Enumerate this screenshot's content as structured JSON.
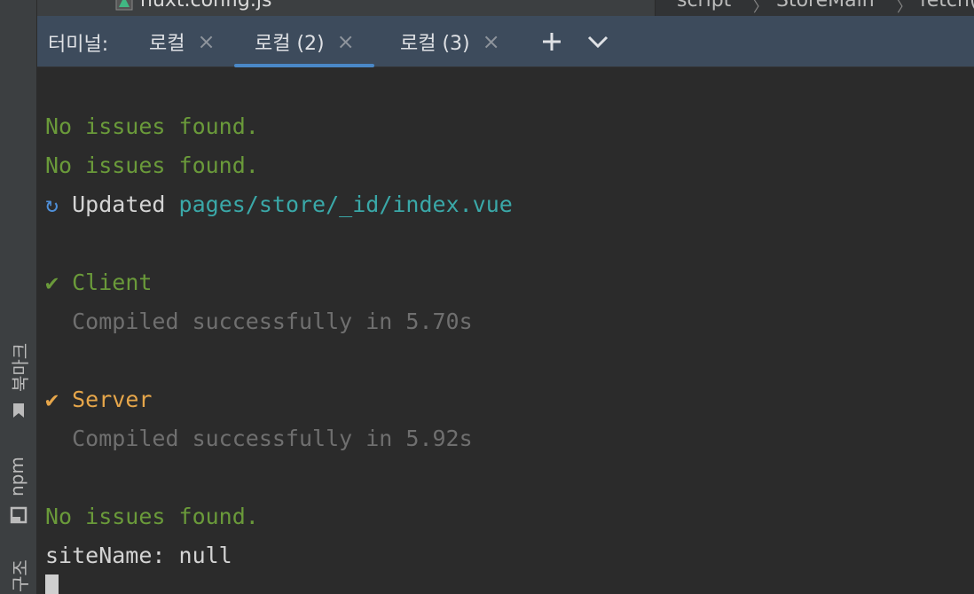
{
  "top_strip": {
    "file_name": "nuxt.config.js",
    "breadcrumb": [
      "script",
      "StoreMain",
      "fetch()"
    ]
  },
  "terminal": {
    "title": "터미널:",
    "tabs": [
      {
        "label": "로컬",
        "active": false
      },
      {
        "label": "로컬 (2)",
        "active": true
      },
      {
        "label": "로컬 (3)",
        "active": false
      }
    ],
    "add_icon": "plus-icon",
    "menu_icon": "chevron-down-icon",
    "lines": [
      {
        "text": "No issues found."
      },
      {
        "text": "No issues found."
      },
      {
        "symbol": "↻",
        "text": "Updated",
        "path": "pages/store/_id/index.vue"
      },
      {
        "symbol": "✔",
        "text": "Client"
      },
      {
        "text": "Compiled successfully in 5.70s"
      },
      {
        "symbol": "✔",
        "text": "Server"
      },
      {
        "text": "Compiled successfully in 5.92s"
      },
      {
        "text": "No issues found."
      },
      {
        "text": "siteName: null"
      }
    ]
  },
  "left_strip": {
    "bookmarks_label": "북마크",
    "npm_label": "npm",
    "structure_label": "구조"
  },
  "colors": {
    "background": "#2b2b2b",
    "tabbar": "#3d4b5c",
    "active_tab_underline": "#4a88c7",
    "success_green": "#6a9a3a",
    "server_orange": "#e6a64a",
    "path_teal": "#3aa8a8"
  }
}
